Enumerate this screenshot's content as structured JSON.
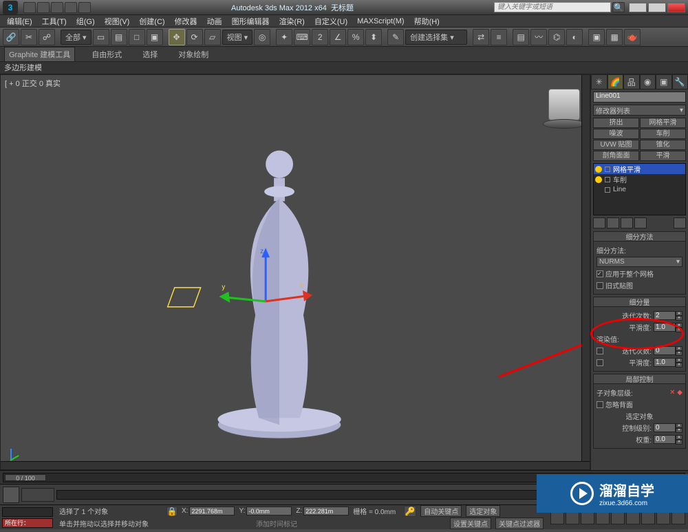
{
  "title": {
    "app": "Autodesk 3ds Max  2012  x64",
    "doc": "无标题",
    "search_placeholder": "键入关键字或短语"
  },
  "menu": {
    "items": [
      "编辑(E)",
      "工具(T)",
      "组(G)",
      "视图(V)",
      "创建(C)",
      "修改器",
      "动画",
      "图形编辑器",
      "渲染(R)",
      "自定义(U)",
      "MAXScript(M)",
      "帮助(H)"
    ]
  },
  "toolbar": {
    "selset_label": "全部 ▾",
    "view_label": "视图 ▾",
    "createsel_label": "创建选择集 ▾"
  },
  "ribbon": {
    "tabs": [
      "Graphite 建模工具",
      "自由形式",
      "选择",
      "对象绘制"
    ],
    "polybar": "多边形建模"
  },
  "viewport": {
    "label": "[ + 0 正交 0 真实"
  },
  "cmdpanel": {
    "objname": "Line001",
    "modlist_label": "修改器列表",
    "modgrid": [
      "挤出",
      "网格平滑",
      "噪波",
      "车削",
      "UVW 贴图",
      "锥化",
      "剖角面面",
      "平滑"
    ],
    "modstack": {
      "items": [
        {
          "label": "网格平滑",
          "sel": true
        },
        {
          "label": "车削",
          "sel": false
        },
        {
          "label": "Line",
          "sel": false
        }
      ]
    },
    "rollups": {
      "subdivMethod": {
        "title": "细分方法",
        "method_label": "细分方法:",
        "method_value": "NURMS",
        "apply_whole": "应用于整个网格",
        "old_map": "旧式贴图"
      },
      "subdivAmt": {
        "title": "细分量",
        "iter_label": "迭代次数:",
        "iter_value": "2",
        "smooth_label": "平滑度:",
        "smooth_value": "1.0",
        "render_label": "渲染值:",
        "r_iter_label": "迭代次数:",
        "r_iter_value": "0",
        "r_smooth_label": "平滑度:",
        "r_smooth_value": "1.0"
      },
      "local": {
        "title": "局部控制",
        "subobj_label": "子对象层级:",
        "ignore_back": "忽略背面",
        "sel_obj": "选定对象",
        "ctl_level_label": "控制级别:",
        "ctl_level_value": "0",
        "weight_label": "权重:",
        "weight_value": "0.0"
      }
    }
  },
  "timeline": {
    "frame": "0 / 100"
  },
  "status": {
    "locked": "所在行：",
    "sel_info": "选择了 1 个对象",
    "hint": "单击并拖动以选择并移动对象",
    "x_label": "X:",
    "x_val": "2291.768m",
    "y_label": "Y:",
    "y_val": "-0.0mm",
    "z_label": "Z:",
    "z_val": "222.281m",
    "grid": "栅格 = 0.0mm",
    "autokey": "自动关键点",
    "selset": "选定对象",
    "setkey": "设置关键点",
    "keyfilter": "关键点过滤器",
    "addtime": "添加时间标记"
  },
  "watermark": {
    "brand": "溜溜自学",
    "sub": "zixue.3d66.com"
  }
}
